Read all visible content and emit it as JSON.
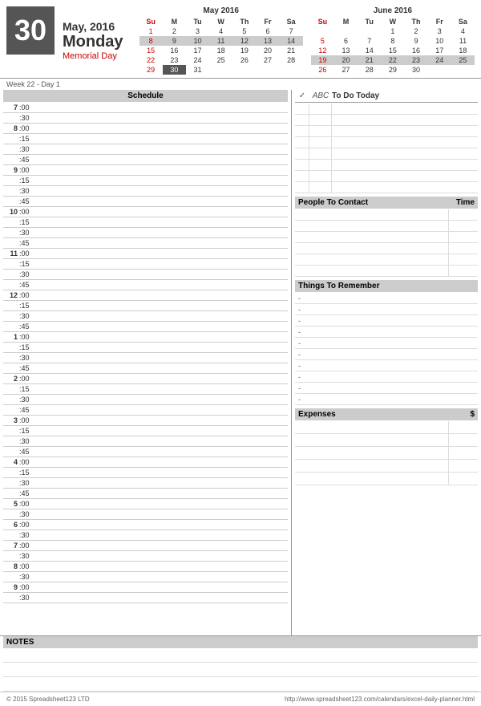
{
  "header": {
    "day_num": "30",
    "month_year": "May, 2016",
    "day_name": "Monday",
    "holiday": "Memorial Day"
  },
  "may_cal": {
    "title": "May 2016",
    "headers": [
      "Su",
      "M",
      "Tu",
      "W",
      "Th",
      "Fr",
      "Sa"
    ],
    "weeks": [
      [
        "1",
        "2",
        "3",
        "4",
        "5",
        "6",
        "7"
      ],
      [
        "8",
        "9",
        "10",
        "11",
        "12",
        "13",
        "14"
      ],
      [
        "15",
        "16",
        "17",
        "18",
        "19",
        "20",
        "21"
      ],
      [
        "22",
        "23",
        "24",
        "25",
        "26",
        "27",
        "28"
      ],
      [
        "29",
        "30",
        "31",
        "",
        "",
        "",
        ""
      ]
    ],
    "today": "30",
    "week5_highlight": [
      "8",
      "9",
      "10",
      "11",
      "12",
      "13",
      "14"
    ]
  },
  "june_cal": {
    "title": "June 2016",
    "headers": [
      "Su",
      "M",
      "Tu",
      "W",
      "Th",
      "Fr",
      "Sa"
    ],
    "weeks": [
      [
        "",
        "",
        "",
        "1",
        "2",
        "3",
        "4"
      ],
      [
        "5",
        "6",
        "7",
        "8",
        "9",
        "10",
        "11"
      ],
      [
        "12",
        "13",
        "14",
        "15",
        "16",
        "17",
        "18"
      ],
      [
        "19",
        "20",
        "21",
        "22",
        "23",
        "24",
        "25"
      ],
      [
        "26",
        "27",
        "28",
        "29",
        "30",
        "",
        ""
      ]
    ],
    "highlight_row": [
      "19",
      "20",
      "21",
      "22",
      "23",
      "24",
      "25"
    ]
  },
  "week_info": "Week 22 - Day 1",
  "schedule": {
    "header": "Schedule",
    "hours": [
      {
        "hour": "7",
        "slots": [
          ":00",
          ":30"
        ]
      },
      {
        "hour": "8",
        "slots": [
          ":00",
          ":15",
          ":30",
          ":45"
        ]
      },
      {
        "hour": "9",
        "slots": [
          ":00",
          ":15",
          ":30",
          ":45"
        ]
      },
      {
        "hour": "10",
        "slots": [
          ":00",
          ":15",
          ":30",
          ":45"
        ]
      },
      {
        "hour": "11",
        "slots": [
          ":00",
          ":15",
          ":30",
          ":45"
        ]
      },
      {
        "hour": "12",
        "slots": [
          ":00",
          ":15",
          ":30",
          ":45"
        ]
      },
      {
        "hour": "1",
        "slots": [
          ":00",
          ":15",
          ":30",
          ":45"
        ]
      },
      {
        "hour": "2",
        "slots": [
          ":00",
          ":15",
          ":30",
          ":45"
        ]
      },
      {
        "hour": "3",
        "slots": [
          ":00",
          ":15",
          ":30",
          ":45"
        ]
      },
      {
        "hour": "4",
        "slots": [
          ":00",
          ":15",
          ":30",
          ":45"
        ]
      },
      {
        "hour": "5",
        "slots": [
          ":00",
          ":30"
        ]
      },
      {
        "hour": "6",
        "slots": [
          ":00",
          ":30"
        ]
      },
      {
        "hour": "7",
        "slots": [
          ":00",
          ":30"
        ]
      },
      {
        "hour": "8",
        "slots": [
          ":00",
          ":30"
        ]
      },
      {
        "hour": "9",
        "slots": [
          ":00",
          ":30"
        ]
      }
    ]
  },
  "todo": {
    "header": "To Do Today",
    "check_label": "✓",
    "abc_label": "ABC",
    "rows": 8
  },
  "contacts": {
    "header": "People To Contact",
    "time_label": "Time",
    "rows": 6
  },
  "remember": {
    "header": "Things To Remember",
    "bullets": [
      "-",
      "-",
      "-",
      "-",
      "-",
      "-",
      "-",
      "-",
      "-",
      "-"
    ]
  },
  "expenses": {
    "header": "Expenses",
    "amount_label": "$",
    "rows": 5
  },
  "notes": {
    "header": "NOTES",
    "rows": 3
  },
  "footer": {
    "left": "© 2015 Spreadsheet123 LTD",
    "right": "http://www.spreadsheet123.com/calendars/excel-daily-planner.html"
  }
}
